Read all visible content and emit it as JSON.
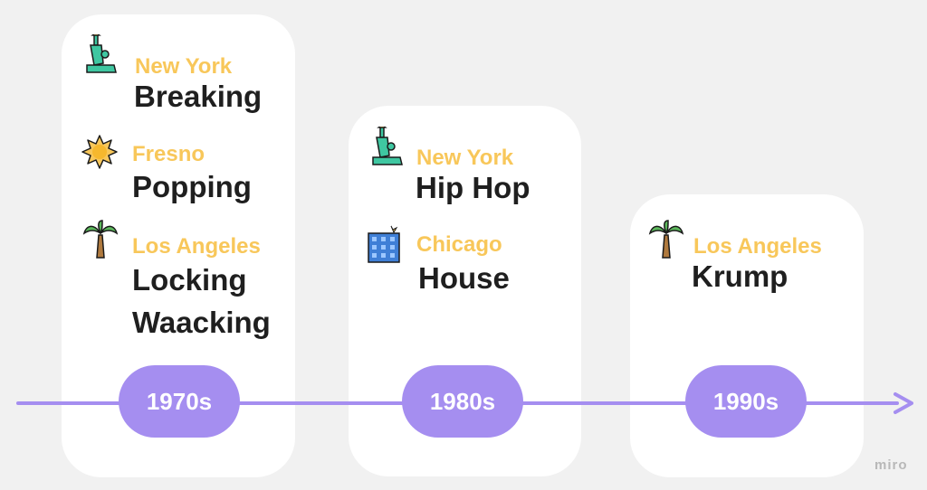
{
  "eras": [
    {
      "decade": "1970s",
      "entries": [
        {
          "icon": "statue-of-liberty-icon",
          "city": "New York",
          "dances": [
            "Breaking"
          ]
        },
        {
          "icon": "sun-icon",
          "city": "Fresno",
          "dances": [
            "Popping"
          ]
        },
        {
          "icon": "palm-tree-icon",
          "city": "Los Angeles",
          "dances": [
            "Locking",
            "Waacking"
          ]
        }
      ]
    },
    {
      "decade": "1980s",
      "entries": [
        {
          "icon": "statue-of-liberty-icon",
          "city": "New York",
          "dances": [
            "Hip Hop"
          ]
        },
        {
          "icon": "office-building-icon",
          "city": "Chicago",
          "dances": [
            "House"
          ]
        }
      ]
    },
    {
      "decade": "1990s",
      "entries": [
        {
          "icon": "palm-tree-icon",
          "city": "Los Angeles",
          "dances": [
            "Krump"
          ]
        }
      ]
    }
  ],
  "colors": {
    "accent": "#a58ef0",
    "city": "#f8c75a",
    "dance": "#1f1f1f",
    "card": "#ffffff",
    "background": "#f1f1f1"
  },
  "watermark": "miro"
}
